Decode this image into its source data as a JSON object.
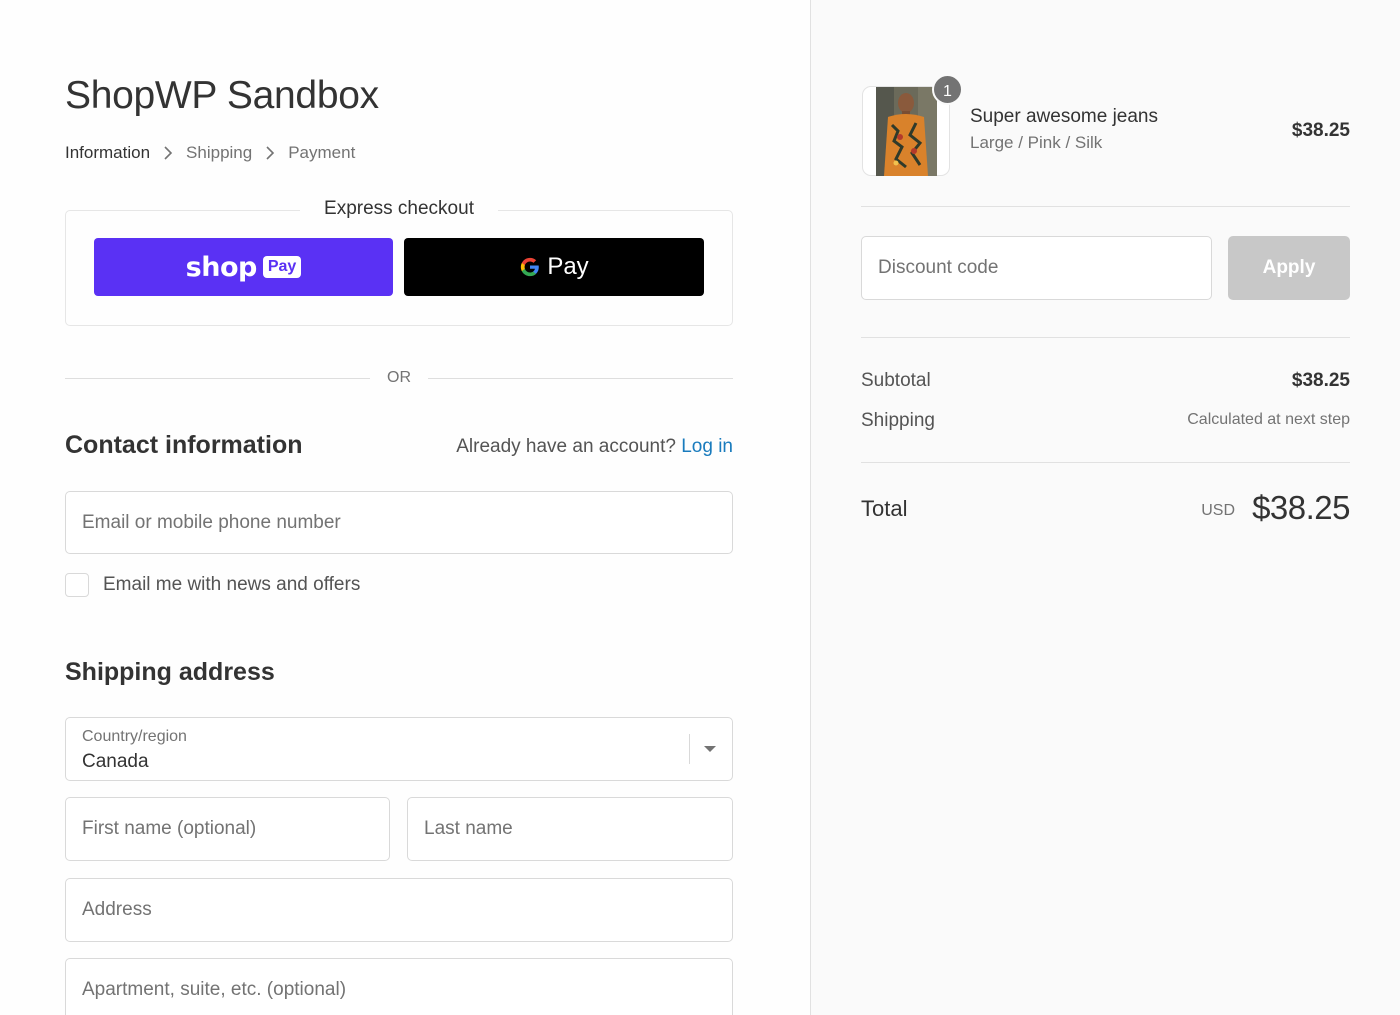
{
  "store": {
    "title": "ShopWP Sandbox"
  },
  "breadcrumb": [
    "Information",
    "Shipping",
    "Payment"
  ],
  "express": {
    "title": "Express checkout",
    "shop_pay": {
      "word": "shop",
      "badge": "Pay"
    },
    "google_pay": {
      "word": "Pay"
    }
  },
  "divider_or": "OR",
  "contact": {
    "heading": "Contact information",
    "account_prompt": "Already have an account?",
    "login_label": "Log in",
    "email_placeholder": "Email or mobile phone number",
    "newsletter_label": "Email me with news and offers"
  },
  "shipping": {
    "heading": "Shipping address",
    "country_label": "Country/region",
    "country_value": "Canada",
    "first_name_placeholder": "First name (optional)",
    "last_name_placeholder": "Last name",
    "address_placeholder": "Address",
    "apartment_placeholder": "Apartment, suite, etc. (optional)"
  },
  "cart": {
    "item": {
      "quantity": "1",
      "name": "Super awesome jeans",
      "variant": "Large / Pink / Silk",
      "price": "$38.25"
    },
    "discount_placeholder": "Discount code",
    "apply_label": "Apply",
    "subtotal_label": "Subtotal",
    "subtotal_value": "$38.25",
    "shipping_label": "Shipping",
    "shipping_value": "Calculated at next step",
    "total_label": "Total",
    "total_currency": "USD",
    "total_value": "$38.25"
  },
  "colors": {
    "shop_pay": "#5a31f4",
    "link": "#197bbd",
    "apply_disabled": "#c8c8c8"
  },
  "icons": [
    "chevron-right-icon",
    "chevron-down-icon",
    "google-g-icon"
  ]
}
